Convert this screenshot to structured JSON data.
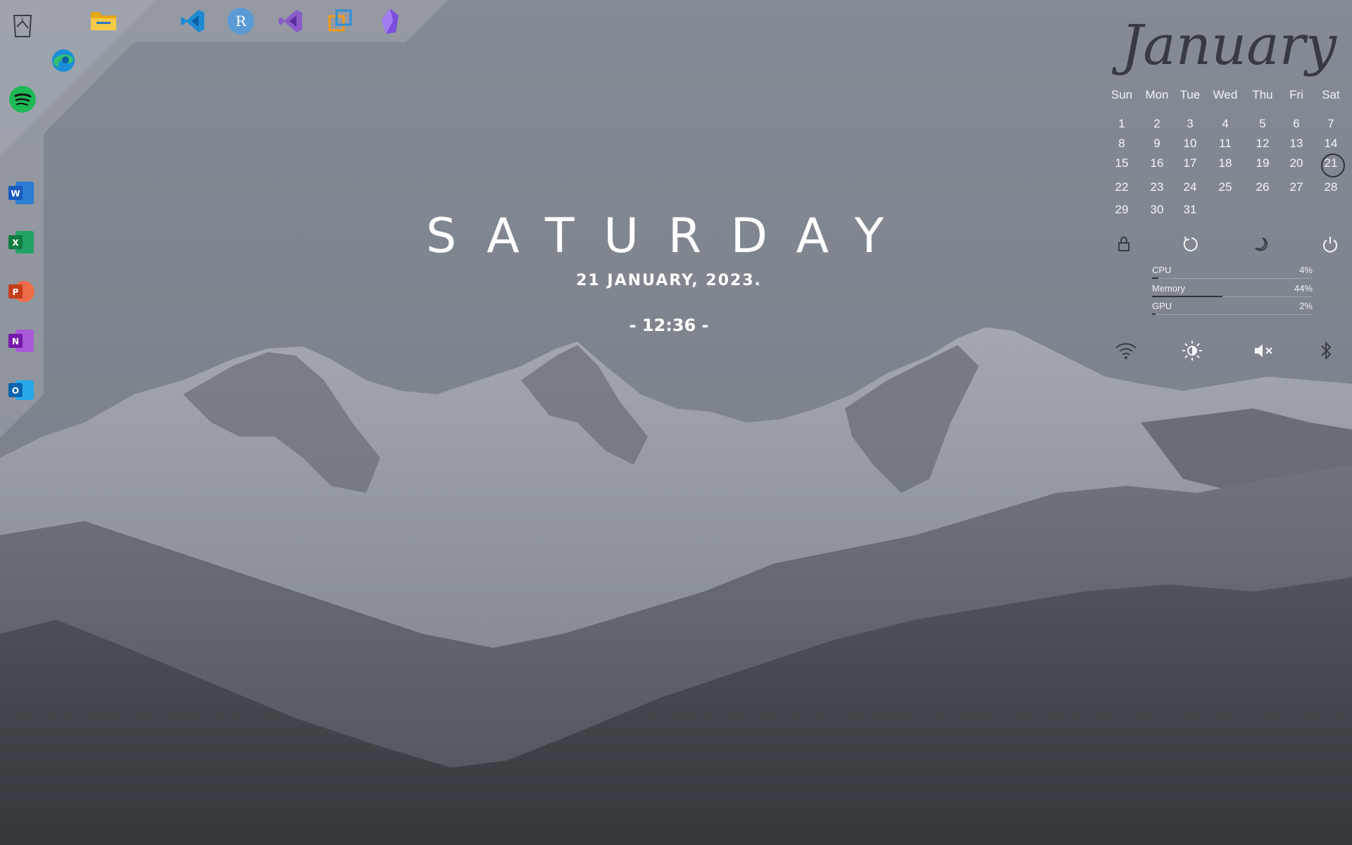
{
  "dock": {
    "top_apps": [
      {
        "name": "Recycle Bin",
        "icon": "recycle-bin-icon"
      },
      {
        "name": "File Explorer",
        "icon": "folder-icon"
      },
      {
        "name": "Visual Studio Code",
        "icon": "vscode-icon"
      },
      {
        "name": "R",
        "icon": "r-icon",
        "letter": "R"
      },
      {
        "name": "Visual Studio",
        "icon": "visual-studio-icon"
      },
      {
        "name": "Window Manager",
        "icon": "windows-squares-icon"
      },
      {
        "name": "Obsidian",
        "icon": "obsidian-icon"
      }
    ],
    "left_apps": [
      {
        "name": "Microsoft Edge",
        "icon": "edge-icon"
      },
      {
        "name": "Spotify",
        "icon": "spotify-icon"
      },
      {
        "name": "Word",
        "icon": "word-icon",
        "letter": "W"
      },
      {
        "name": "Excel",
        "icon": "excel-icon",
        "letter": "X"
      },
      {
        "name": "PowerPoint",
        "icon": "powerpoint-icon",
        "letter": "P"
      },
      {
        "name": "OneNote",
        "icon": "onenote-icon",
        "letter": "N"
      },
      {
        "name": "Outlook",
        "icon": "outlook-icon",
        "letter": "O"
      }
    ]
  },
  "clock": {
    "day": "SATURDAY",
    "date": "21 JANUARY, 2023.",
    "time": "- 12:36 -"
  },
  "calendar": {
    "month": "January",
    "weekdays": [
      "Sun",
      "Mon",
      "Tue",
      "Wed",
      "Thu",
      "Fri",
      "Sat"
    ],
    "weeks": [
      [
        "1",
        "2",
        "3",
        "4",
        "5",
        "6",
        "7"
      ],
      [
        "8",
        "9",
        "10",
        "11",
        "12",
        "13",
        "14"
      ],
      [
        "15",
        "16",
        "17",
        "18",
        "19",
        "20",
        "21"
      ],
      [
        "22",
        "23",
        "24",
        "25",
        "26",
        "27",
        "28"
      ],
      [
        "29",
        "30",
        "31",
        "",
        "",
        "",
        ""
      ]
    ],
    "today": "21"
  },
  "power": [
    "lock-icon",
    "restart-icon",
    "sleep-icon",
    "power-icon"
  ],
  "meters": [
    {
      "label": "CPU",
      "value": "4%",
      "fraction": 0.04
    },
    {
      "label": "Memory",
      "value": "44%",
      "fraction": 0.44
    },
    {
      "label": "GPU",
      "value": "2%",
      "fraction": 0.02
    }
  ],
  "quick": [
    "wifi-icon",
    "brightness-icon",
    "mute-icon",
    "bluetooth-icon"
  ],
  "colors": {
    "accent_dark": "#2f3238",
    "text": "#ffffff"
  }
}
